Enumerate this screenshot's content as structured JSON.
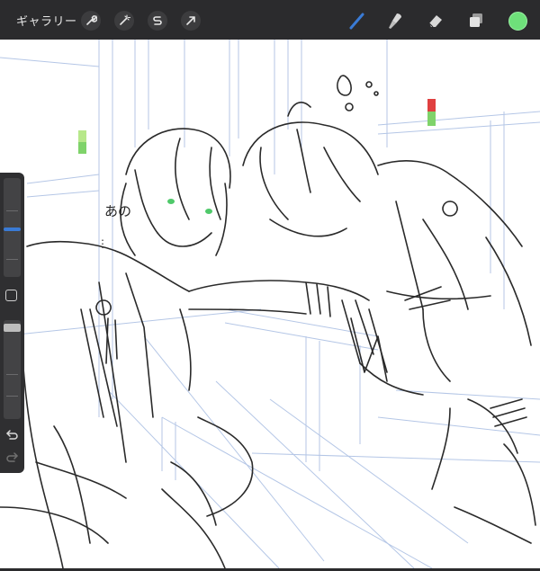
{
  "toolbar": {
    "gallery_label": "ギャラリー",
    "left_tools": [
      {
        "name": "wrench-icon"
      },
      {
        "name": "magic-wand-icon"
      },
      {
        "name": "selection-s-icon"
      },
      {
        "name": "arrow-cursor-icon"
      }
    ],
    "right_tools": [
      {
        "name": "brush-icon",
        "active": true
      },
      {
        "name": "smudge-icon"
      },
      {
        "name": "eraser-icon"
      },
      {
        "name": "layers-icon"
      }
    ],
    "current_color": "#6ee07a"
  },
  "canvas": {
    "annotation_text": "あの",
    "annotation_dots": "⋮"
  },
  "sidebar": {
    "brush_size_level": 0.35,
    "opacity_level": 0.92,
    "undo_icon": "undo-icon",
    "redo_icon": "redo-icon"
  },
  "colors": {
    "toolbar_bg": "#2b2b2d",
    "accent_blue": "#3a7bd5",
    "green": "#6ee07a",
    "guide_blue": "#9db3dc"
  }
}
